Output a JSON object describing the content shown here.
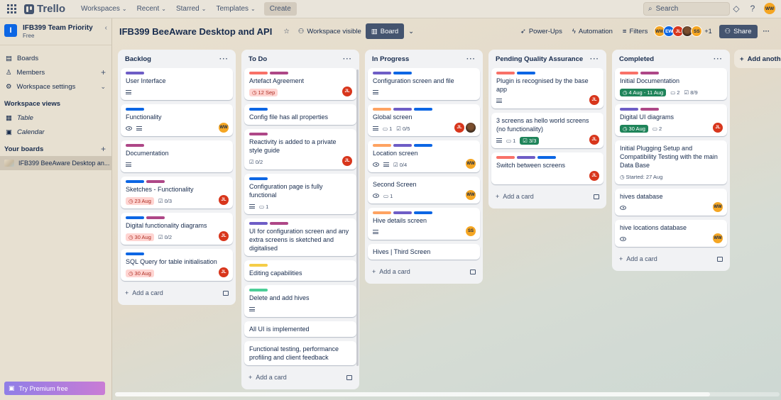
{
  "topbar": {
    "app_name": "Trello",
    "menus": [
      "Workspaces",
      "Recent",
      "Starred",
      "Templates"
    ],
    "create_label": "Create",
    "search_placeholder": "Search",
    "user_initials": "WW"
  },
  "sidebar": {
    "workspace_name": "IFB399 Team Priority",
    "workspace_plan": "Free",
    "workspace_badge": "I",
    "items": [
      {
        "label": "Boards",
        "icon": "boards-icon"
      },
      {
        "label": "Members",
        "icon": "members-icon"
      },
      {
        "label": "Workspace settings",
        "icon": "gear-icon"
      }
    ],
    "views_heading": "Workspace views",
    "views": [
      {
        "label": "Table",
        "icon": "table-icon"
      },
      {
        "label": "Calendar",
        "icon": "calendar-icon"
      }
    ],
    "boards_heading": "Your boards",
    "boards": [
      "IFB399 BeeAware Desktop an..."
    ],
    "premium_label": "Try Premium free"
  },
  "board": {
    "title": "IFB399 BeeAware Desktop and API",
    "visibility": "Workspace visible",
    "view": "Board",
    "powerups": "Power-Ups",
    "automation": "Automation",
    "filters": "Filters",
    "members": [
      "WW",
      "EW",
      "JL",
      "",
      "SS"
    ],
    "extra_members": "+1",
    "share": "Share",
    "add_list": "Add another list",
    "add_card": "Add a card"
  },
  "colors": {
    "green": "#4bce97",
    "yellow": "#f5cd47",
    "orange": "#fea362",
    "red": "#f87168",
    "purple": "#9f8fef",
    "blue": "#0c66e4",
    "pink": "#ae4787",
    "violet": "#6e5dc6",
    "dkblue": "#1d7afc"
  },
  "lists": [
    {
      "name": "Backlog",
      "cards": [
        {
          "title": "User Interface",
          "labels": [
            "violet"
          ],
          "badges": [
            "desc"
          ],
          "members": []
        },
        {
          "title": "Functionality",
          "labels": [
            "blue"
          ],
          "badges": [
            "eye",
            "desc"
          ],
          "members": [
            "WW"
          ]
        },
        {
          "title": "Documentation",
          "labels": [
            "pink"
          ],
          "badges": [
            "desc"
          ],
          "members": []
        },
        {
          "title": "Sketches - Functionality",
          "labels": [
            "blue",
            "pink"
          ],
          "due": "23 Aug",
          "due_style": "red",
          "checklist": "0/3",
          "members": [
            "JL"
          ]
        },
        {
          "title": "Digital functionality diagrams",
          "labels": [
            "blue",
            "pink"
          ],
          "due": "30 Aug",
          "due_style": "red",
          "checklist": "0/2",
          "members": [
            "JL"
          ]
        },
        {
          "title": "SQL Query for table initialisation",
          "labels": [
            "blue"
          ],
          "due": "30 Aug",
          "due_style": "red",
          "members": [
            "JL"
          ]
        }
      ]
    },
    {
      "name": "To Do",
      "cards": [
        {
          "title": "Artefact Agreement",
          "labels": [
            "red",
            "pink"
          ],
          "due": "12 Sep",
          "due_style": "red",
          "members": [
            "JL"
          ]
        },
        {
          "title": "Config file has all properties",
          "labels": [
            "blue"
          ],
          "members": []
        },
        {
          "title": "Reactivity is added to a private style guide",
          "labels": [
            "pink"
          ],
          "checklist": "0/2",
          "members": [
            "JL"
          ]
        },
        {
          "title": "Configuration page is fully functional",
          "labels": [
            "blue"
          ],
          "badges": [
            "desc"
          ],
          "comments": "1",
          "members": []
        },
        {
          "title": "UI for configuration screen and any extra screens is sketched and digitalised",
          "labels": [
            "violet",
            "pink"
          ],
          "members": []
        },
        {
          "title": "Editing capabilities",
          "labels": [
            "yellow"
          ],
          "members": []
        },
        {
          "title": "Delete and add hives",
          "labels": [
            "green"
          ],
          "badges": [
            "desc"
          ],
          "members": []
        },
        {
          "title": "All UI is implemented",
          "labels": [],
          "members": []
        },
        {
          "title": "Functional testing, performance profiling and client feedback",
          "labels": [],
          "members": []
        }
      ]
    },
    {
      "name": "In Progress",
      "cards": [
        {
          "title": "Configuration screen and file",
          "labels": [
            "violet",
            "blue"
          ],
          "badges": [
            "desc"
          ],
          "members": []
        },
        {
          "title": "Global screen",
          "labels": [
            "orange",
            "violet",
            "blue"
          ],
          "badges": [
            "desc"
          ],
          "comments": "1",
          "checklist": "0/5",
          "members": [
            "JL",
            "photo"
          ]
        },
        {
          "title": "Location screen",
          "labels": [
            "orange",
            "violet",
            "blue"
          ],
          "badges": [
            "eye",
            "desc"
          ],
          "checklist": "0/4",
          "members": [
            "WW"
          ]
        },
        {
          "title": "Second Screen",
          "labels": [],
          "badges": [
            "eye"
          ],
          "comments": "1",
          "members": [
            "WW"
          ]
        },
        {
          "title": "Hive details screen",
          "labels": [
            "orange",
            "violet",
            "blue"
          ],
          "badges": [
            "desc"
          ],
          "members": [
            "SS"
          ]
        },
        {
          "title": "Hives | Third Screen",
          "labels": [],
          "members": []
        }
      ]
    },
    {
      "name": "Pending Quality Assurance",
      "cards": [
        {
          "title": "Plugin is recognised by the base app",
          "labels": [
            "red",
            "blue"
          ],
          "badges": [
            "desc"
          ],
          "members": [
            "JL"
          ]
        },
        {
          "title": "3 screens as hello world screens (no functionality)",
          "labels": [],
          "badges": [
            "desc"
          ],
          "comments": "1",
          "checklist_done": "3/3",
          "members": [
            "JL"
          ]
        },
        {
          "title": "Switch between screens",
          "labels": [
            "red",
            "violet",
            "blue"
          ],
          "members": [
            "JL"
          ]
        }
      ]
    },
    {
      "name": "Completed",
      "cards": [
        {
          "title": "Initial Documentation",
          "labels": [
            "red",
            "pink"
          ],
          "due": "4 Aug - 11 Aug",
          "due_style": "green",
          "comments": "2",
          "checklist": "8/9",
          "members": []
        },
        {
          "title": "Digital UI diagrams",
          "labels": [
            "violet",
            "pink"
          ],
          "due": "30 Aug",
          "due_style": "green",
          "comments": "2",
          "members": [
            "JL"
          ]
        },
        {
          "title": "Initial Plugging Setup and Compatibility Testing with the main Data Base",
          "labels": [],
          "started": "Started: 27 Aug",
          "members": []
        },
        {
          "title": "hives database",
          "labels": [],
          "badges": [
            "eye"
          ],
          "members": [
            "WW"
          ]
        },
        {
          "title": "hive locations database",
          "labels": [],
          "badges": [
            "eye"
          ],
          "members": [
            "WW"
          ]
        }
      ]
    }
  ]
}
